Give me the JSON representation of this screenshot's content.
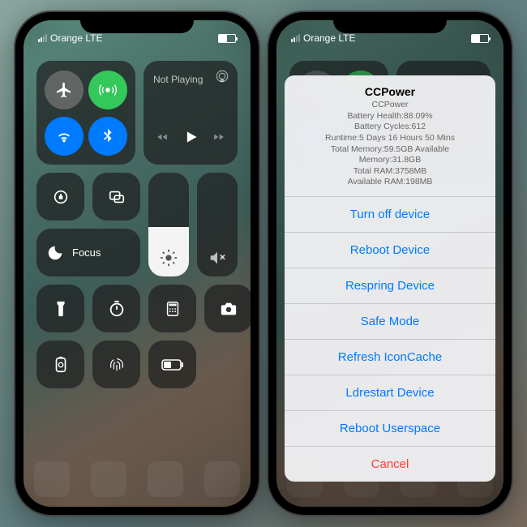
{
  "status": {
    "carrier": "Orange LTE"
  },
  "media": {
    "title": "Not Playing"
  },
  "focus": {
    "label": "Focus"
  },
  "brightness": {
    "level_pct": 48
  },
  "volume": {
    "level_pct": 0
  },
  "action_sheet": {
    "title": "CCPower",
    "info_lines": [
      "CCPower",
      "Battery Health:88.09%",
      "Battery Cycles:612",
      "Runtime:5 Days 16 Hours 50 Mins",
      "Total Memory:59.5GB Available",
      "Memory:31.8GB",
      "Total RAM:3758MB",
      "Available RAM:198MB"
    ],
    "actions": [
      "Turn off device",
      "Reboot Device",
      "Respring Device",
      "Safe Mode",
      "Refresh IconCache",
      "Ldrestart Device",
      "Reboot Userspace"
    ],
    "cancel": "Cancel"
  },
  "icons": {
    "airplane": "airplane-icon",
    "cellular": "cellular-icon",
    "wifi": "wifi-icon",
    "bluetooth": "bluetooth-icon",
    "airplay": "airplay-icon",
    "lock_rotation": "rotation-lock-icon",
    "screen_mirror": "screen-mirror-icon",
    "moon": "moon-icon",
    "brightness": "sun-icon",
    "mute": "mute-icon",
    "flashlight": "flashlight-icon",
    "timer": "timer-icon",
    "calculator": "calculator-icon",
    "camera": "camera-icon",
    "low_power": "low-power-icon",
    "touchid": "touchid-icon",
    "battery_tile": "battery-tile-icon"
  },
  "colors": {
    "ios_blue": "#007aff",
    "ios_green": "#34c759",
    "ios_red": "#ff3b30"
  }
}
